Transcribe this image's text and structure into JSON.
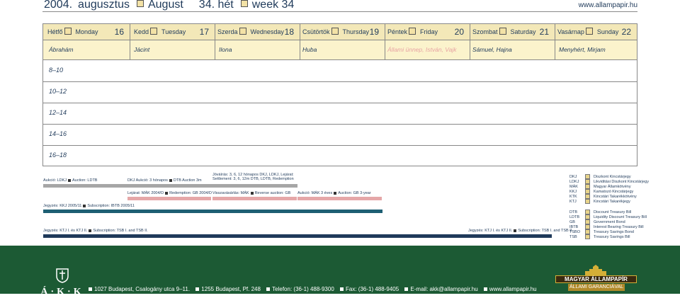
{
  "header": {
    "year": "2004.",
    "month_hu": "augusztus",
    "month_en": "August",
    "week_hu": "34. hét",
    "week_en": "week 34",
    "url": "www.allampapir.hu"
  },
  "days": [
    {
      "hu": "Hétfő",
      "en": "Monday",
      "num": "16"
    },
    {
      "hu": "Kedd",
      "en": "Tuesday",
      "num": "17"
    },
    {
      "hu": "Szerda",
      "en": "Wednesday",
      "num": "18"
    },
    {
      "hu": "Csütörtök",
      "en": "Thursday",
      "num": "19"
    },
    {
      "hu": "Péntek",
      "en": "Friday",
      "num": "20"
    },
    {
      "hu": "Szombat",
      "en": "Saturday",
      "num": "21"
    },
    {
      "hu": "Vasárnap",
      "en": "Sunday",
      "num": "22"
    }
  ],
  "namedays": [
    "Ábrahám",
    "Jácint",
    "Ilona",
    "Huba",
    "Állami ünnep, István, Vajk",
    "Sámuel, Hajna",
    "Menyhért, Mirjam"
  ],
  "time_slots": [
    "8–10",
    "10–12",
    "12–14",
    "14–16",
    "16–18"
  ],
  "events": {
    "mon_auction": "Aukció: LDKJ",
    "mon_auction_en": "Auction: LDTB",
    "tue_auction": "DKJ Aukció: 3 hónapos",
    "tue_auction_en": "DTB Auction 3m",
    "wed_settle_hu": "Jóváírás: 3, 6, 12 hónapos DKJ, LDKJ, Lejárat:",
    "wed_settle_en": "Settlement: 3, 6, 12m DTB, LDTB, Redemption",
    "tue_maturity": "Lejárat: MÁK 2004/D",
    "tue_maturity_en": "Redemption: GB 2004/D",
    "wed_reverse": "Visszavásárlás: MÁK",
    "wed_reverse_en": "Reverse auction: GB",
    "thu_auction": "Aukció: MÁK 3 éves",
    "thu_auction_en": "Auction: GB 3-year",
    "mon_subscr": "Jegyzés: KKJ 2005/11",
    "mon_subscr_en": "Subscription: IBTB 2005/11",
    "mon_subscr2": "Jegyzés: KTJ I. és KTJ II.",
    "mon_subscr2_en": "Subscription: TSB I. and TSB II.",
    "fri_subscr": "Jegyzés: KTJ I. és KTJ II.",
    "fri_subscr_en": "Subscription: TSB I. and TSB II."
  },
  "legend": [
    {
      "code": "DKJ",
      "label": "Diszkont Kincstárjegy"
    },
    {
      "code": "LDKJ",
      "label": "Likviditási Diszkont Kincstárjegy"
    },
    {
      "code": "MÁK",
      "label": "Magyar Államkötvény"
    },
    {
      "code": "KKJ",
      "label": "Kamatozó Kincstárjegy"
    },
    {
      "code": "KTK",
      "label": "Kincstári Takarékkötvény"
    },
    {
      "code": "KTJ",
      "label": "Kincstári Takarékjegy"
    },
    {
      "code": "DTB",
      "label": "Discount Treasury Bill"
    },
    {
      "code": "LDTB",
      "label": "Liquidity Discount Treasury Bill"
    },
    {
      "code": "GB",
      "label": "Government Bond"
    },
    {
      "code": "IBTB",
      "label": "Interest Bearing Treasury Bill"
    },
    {
      "code": "TSBO",
      "label": "Treasury Savings Bond"
    },
    {
      "code": "TSB",
      "label": "Treasury Savings Bill"
    }
  ],
  "footer": {
    "logo": "Á·K·K",
    "address1": "1027 Budapest, Csalogány utca 9–11.",
    "address2": "1255 Budapest, Pf. 248",
    "phone": "Telefon: (36-1) 488-9300",
    "fax": "Fax: (36-1) 488-9405",
    "email": "E-mail: akk@allampapir.hu",
    "web": "www.allampapir.hu",
    "badge_top": "MAGYAR ÁLLAMPAPÍR",
    "badge_bottom": "ÁLLAMI GARANCIÁVAL"
  },
  "colors": {
    "day_header_bg": "#f3e8b8",
    "names_bg": "#fbf3cc",
    "bar_gray": "#a6a6a6",
    "bar_pink": "#e5a7a8",
    "bar_navy": "#1f3a5a",
    "bar_teal": "#1e5f73",
    "footer_green": "#1c5a34",
    "holiday": "#e7a3a3"
  }
}
